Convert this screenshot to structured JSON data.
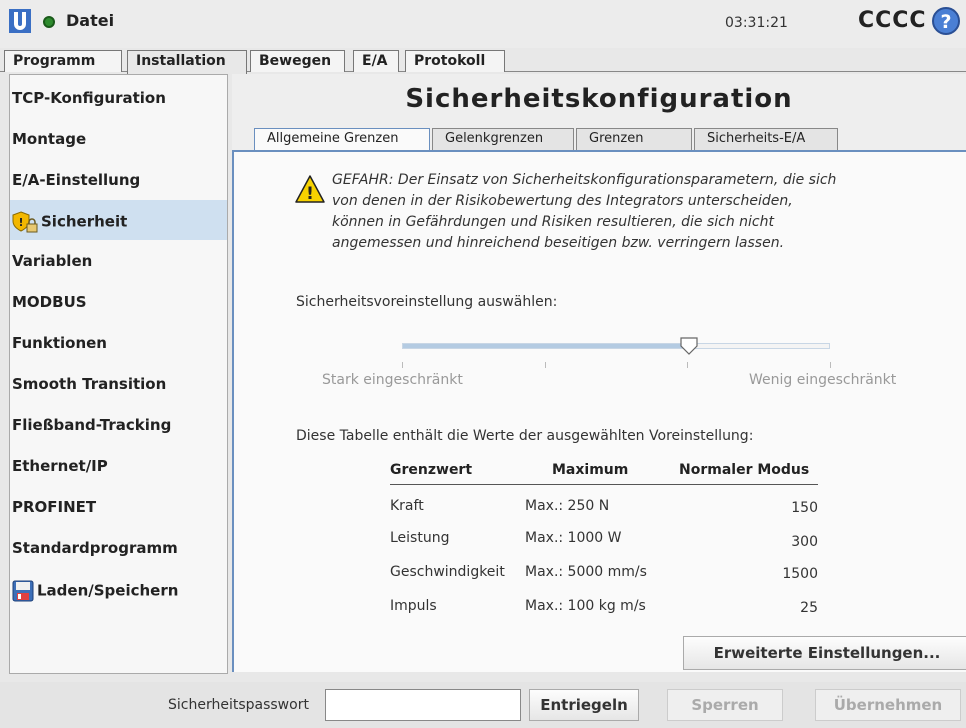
{
  "titlebar": {
    "file_menu": "Datei",
    "time": "03:31:21",
    "robot_name": "CCCC"
  },
  "main_tabs": [
    "Programm",
    "Installation",
    "Bewegen",
    "E/A",
    "Protokoll"
  ],
  "main_tabs_active": "Installation",
  "sidebar": {
    "items": [
      {
        "label": "TCP-Konfiguration"
      },
      {
        "label": "Montage"
      },
      {
        "label": "E/A-Einstellung"
      },
      {
        "label": "Sicherheit",
        "icon": "shield-lock-icon",
        "active": true
      },
      {
        "label": "Variablen"
      },
      {
        "label": "MODBUS"
      },
      {
        "label": "Funktionen"
      },
      {
        "label": "Smooth Transition"
      },
      {
        "label": "Fließband-Tracking"
      },
      {
        "label": "Ethernet/IP"
      },
      {
        "label": "PROFINET"
      },
      {
        "label": "Standardprogramm"
      },
      {
        "label": "Laden/Speichern",
        "icon": "save-disk-icon"
      }
    ]
  },
  "content": {
    "title": "Sicherheitskonfiguration",
    "subtabs": [
      "Allgemeine Grenzen",
      "Gelenkgrenzen",
      "Grenzen",
      "Sicherheits-E/A"
    ],
    "subtabs_active": "Allgemeine Grenzen",
    "warning": {
      "icon": "warning-triangle-icon",
      "line1": "GEFAHR: Der Einsatz von Sicherheitskonfigurationsparametern, die sich",
      "line2": "von denen in der Risikobewertung des Integrators unterscheiden,",
      "line3": "können in Gefährdungen und Risiken resultieren, die sich nicht",
      "line4": "angemessen und hinreichend beseitigen bzw. verringern lassen."
    },
    "preset_label": "Sicherheitsvoreinstellung auswählen:",
    "slider": {
      "value_fraction": 0.67,
      "left_label": "Stark eingeschränkt",
      "right_label": "Wenig eingeschränkt"
    },
    "table_caption": "Diese Tabelle enthält die Werte der ausgewählten Voreinstellung:",
    "table": {
      "headers": [
        "Grenzwert",
        "Maximum",
        "Normaler Modus"
      ],
      "rows": [
        [
          "Kraft",
          "Max.: 250 N",
          "150"
        ],
        [
          "Leistung",
          "Max.: 1000 W",
          "300"
        ],
        [
          "Geschwindigkeit",
          "Max.: 5000 mm/s",
          "1500"
        ],
        [
          "Impuls",
          "Max.: 100 kg m/s",
          "25"
        ]
      ]
    },
    "advanced_button": "Erweiterte Einstellungen..."
  },
  "bottombar": {
    "password_label": "Sicherheitspasswort",
    "password_value": "",
    "unlock": "Entriegeln",
    "lock": "Sperren",
    "apply": "Übernehmen"
  },
  "colors": {
    "accent": "#6a8fbf",
    "sidebar_active": "#cfe0f0",
    "slider_fill": "#b4cbe2",
    "status_green": "#2e8b2e",
    "help_blue": "#3a6fc4"
  }
}
